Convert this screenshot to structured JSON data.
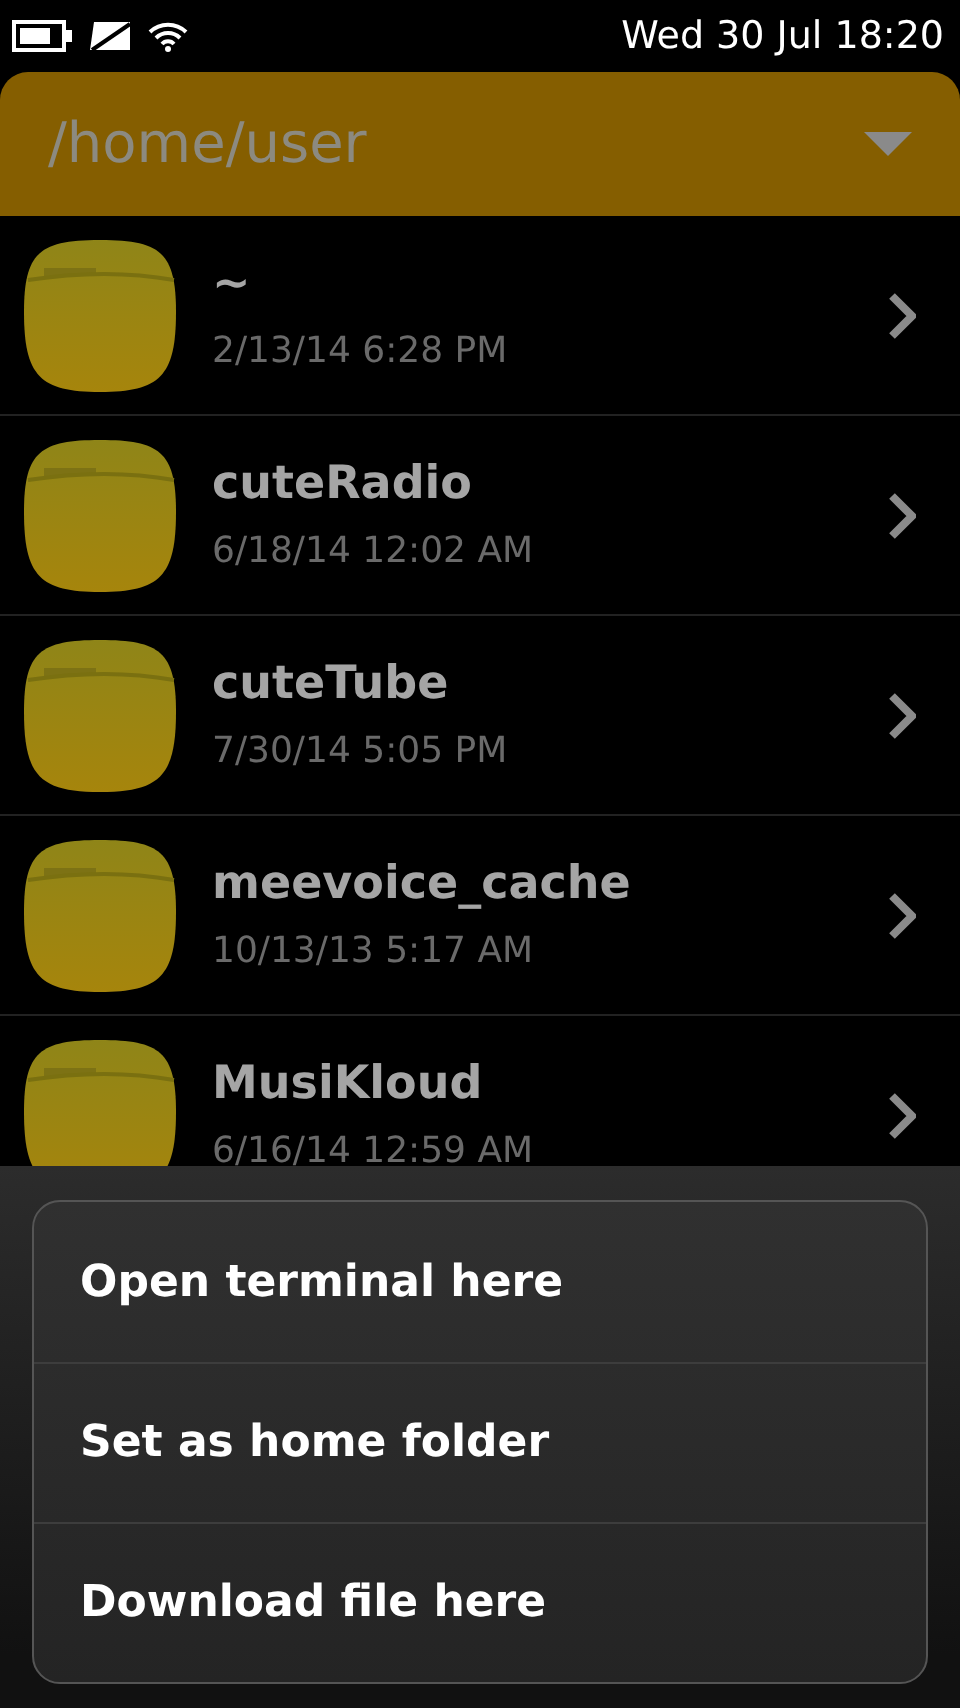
{
  "status_bar": {
    "time": "Wed 30 Jul 18:20"
  },
  "header": {
    "path": "/home/user"
  },
  "folders": [
    {
      "name": "~",
      "date": "2/13/14 6:28 PM"
    },
    {
      "name": "cuteRadio",
      "date": "6/18/14 12:02 AM"
    },
    {
      "name": "cuteTube",
      "date": "7/30/14 5:05 PM"
    },
    {
      "name": "meevoice_cache",
      "date": "10/13/13 5:17 AM"
    },
    {
      "name": "MusiKloud",
      "date": "6/16/14 12:59 AM"
    }
  ],
  "context_menu": {
    "items": [
      "Open terminal here",
      "Set as home folder",
      "Download file here"
    ]
  }
}
